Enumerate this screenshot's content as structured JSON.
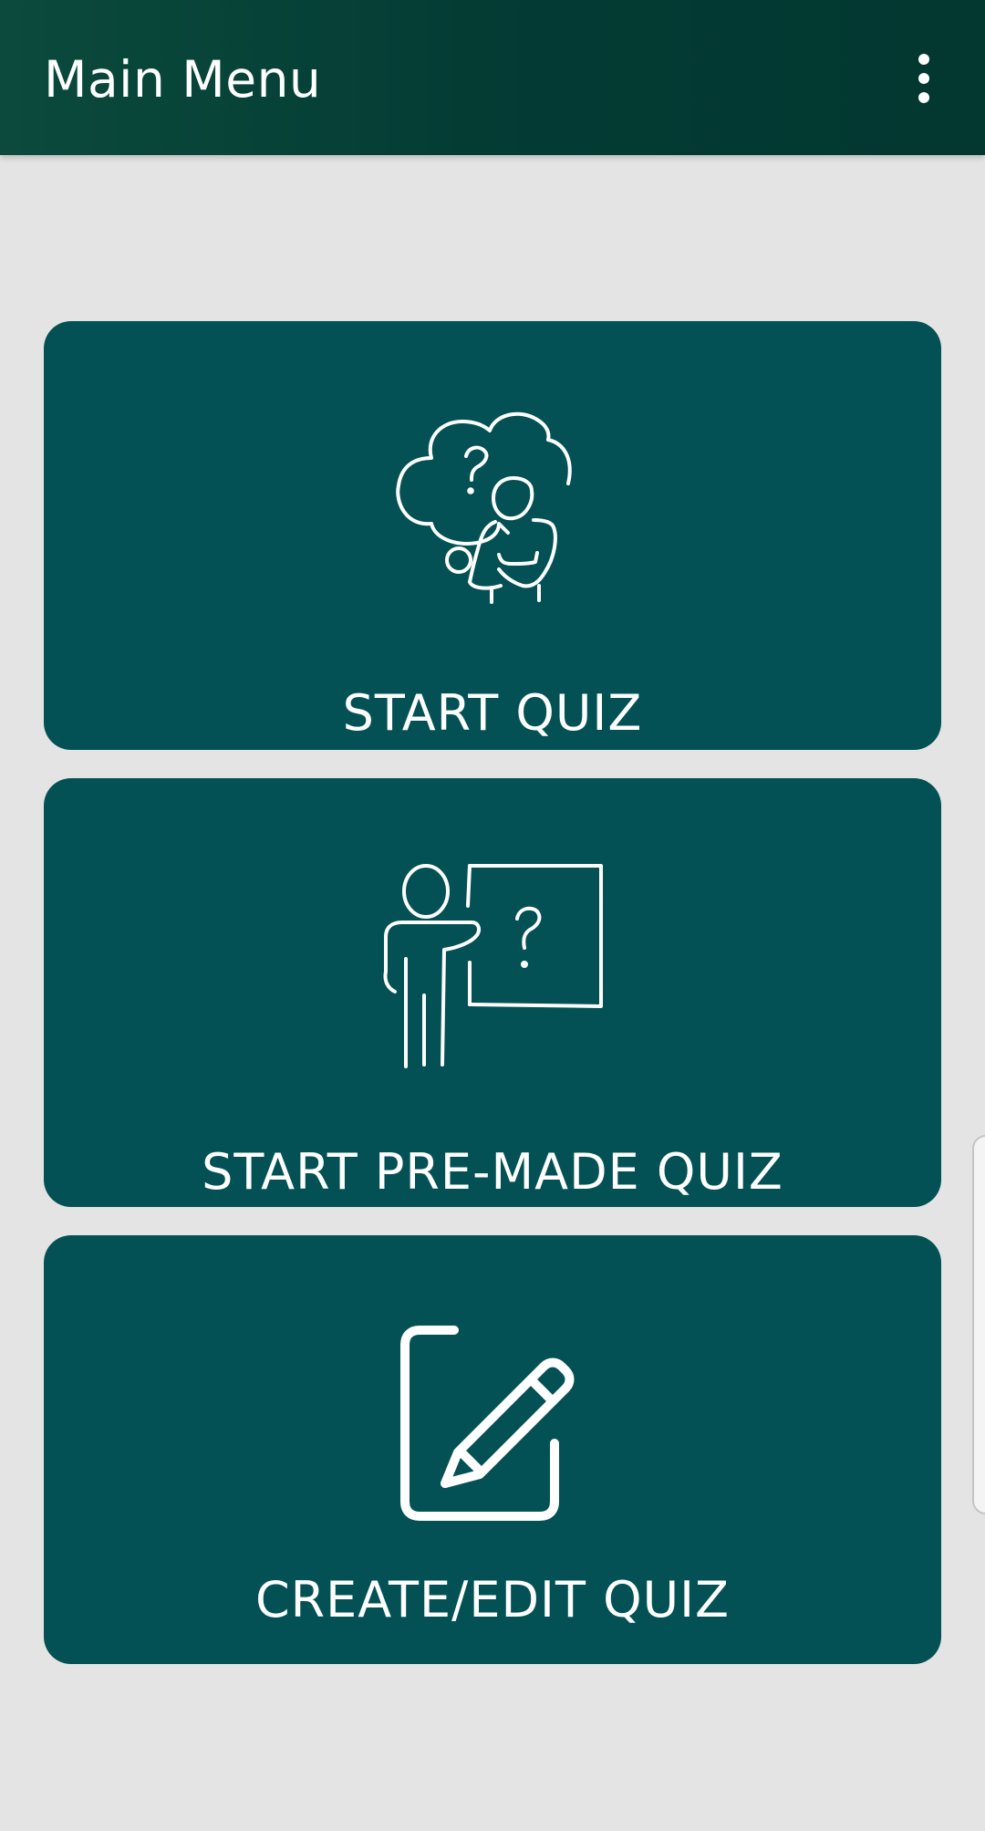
{
  "app_bar": {
    "title": "Main Menu",
    "overflow_icon": "more-vertical-icon"
  },
  "menu_cards": [
    {
      "label": "START QUIZ",
      "icon": "thinking-person-icon"
    },
    {
      "label": "START PRE-MADE QUIZ",
      "icon": "teacher-board-icon"
    },
    {
      "label": "CREATE/EDIT QUIZ",
      "icon": "edit-pencil-icon"
    }
  ],
  "colors": {
    "app_bar": "#033a33",
    "card": "#035155",
    "background": "#e4e4e4",
    "text": "#ffffff"
  }
}
